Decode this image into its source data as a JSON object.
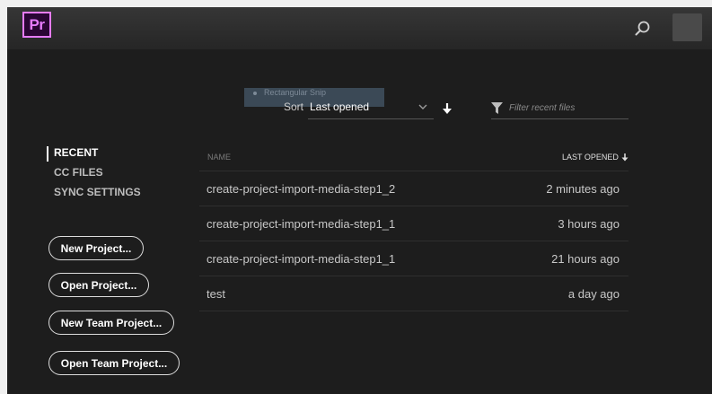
{
  "app": {
    "logo_text": "Pr"
  },
  "header": {
    "search_icon": "search-icon",
    "avatar": "user-avatar"
  },
  "tooltip": {
    "text": "Rectangular Snip"
  },
  "sort": {
    "label": "Sort",
    "value": "Last opened",
    "direction": "descending"
  },
  "filter": {
    "placeholder": "Filter recent files",
    "value": ""
  },
  "nav": [
    {
      "label": "RECENT",
      "active": true
    },
    {
      "label": "CC FILES",
      "active": false
    },
    {
      "label": "SYNC SETTINGS",
      "active": false
    }
  ],
  "buttons": {
    "new_project": "New Project...",
    "open_project": "Open Project...",
    "new_team_project": "New Team Project...",
    "open_team_project": "Open Team Project..."
  },
  "table": {
    "col_name": "NAME",
    "col_last_opened": "LAST OPENED",
    "rows": [
      {
        "name": "create-project-import-media-step1_2",
        "last_opened": "2 minutes ago"
      },
      {
        "name": "create-project-import-media-step1_1",
        "last_opened": "3 hours ago"
      },
      {
        "name": "create-project-import-media-step1_1",
        "last_opened": "21 hours ago"
      },
      {
        "name": "test",
        "last_opened": "a day ago"
      }
    ]
  },
  "colors": {
    "background": "#1d1d1d",
    "brand_accent": "#e77cff",
    "brand_bg": "#2a0634"
  }
}
